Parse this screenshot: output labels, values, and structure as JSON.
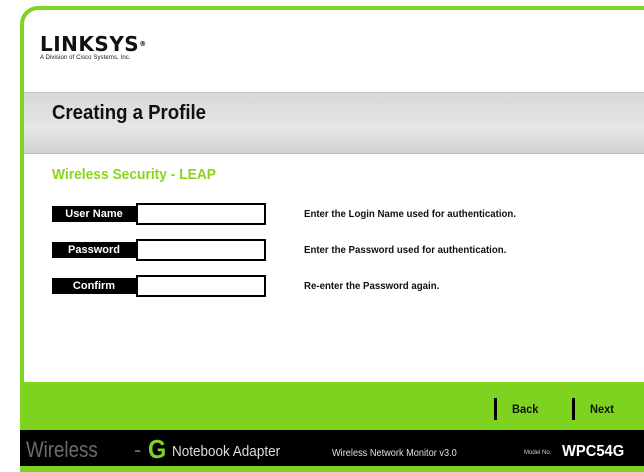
{
  "header": {
    "logo_text": "LINKSYS",
    "logo_tagline": "A Division of Cisco Systems, Inc."
  },
  "page": {
    "title": "Creating a Profile",
    "section_title": "Wireless Security - LEAP"
  },
  "form": {
    "fields": [
      {
        "label": "User Name",
        "value": "",
        "help": "Enter the Login Name used for authentication."
      },
      {
        "label": "Password",
        "value": "",
        "help": "Enter the Password used for authentication."
      },
      {
        "label": "Confirm",
        "value": "",
        "help": "Re-enter the Password again."
      }
    ]
  },
  "nav": {
    "back_label": "Back",
    "next_label": "Next"
  },
  "footer": {
    "brand_wireless": "Wireless",
    "brand_dash": "-",
    "brand_g": "G",
    "brand_rest": "Notebook Adapter",
    "app_name": "Wireless Network Monitor v3.0",
    "model_label": "Model No.",
    "model_value": "WPC54G"
  },
  "colors": {
    "accent_green": "#7ed321",
    "section_green": "#8cd41c",
    "footer_bg": "#000000"
  }
}
